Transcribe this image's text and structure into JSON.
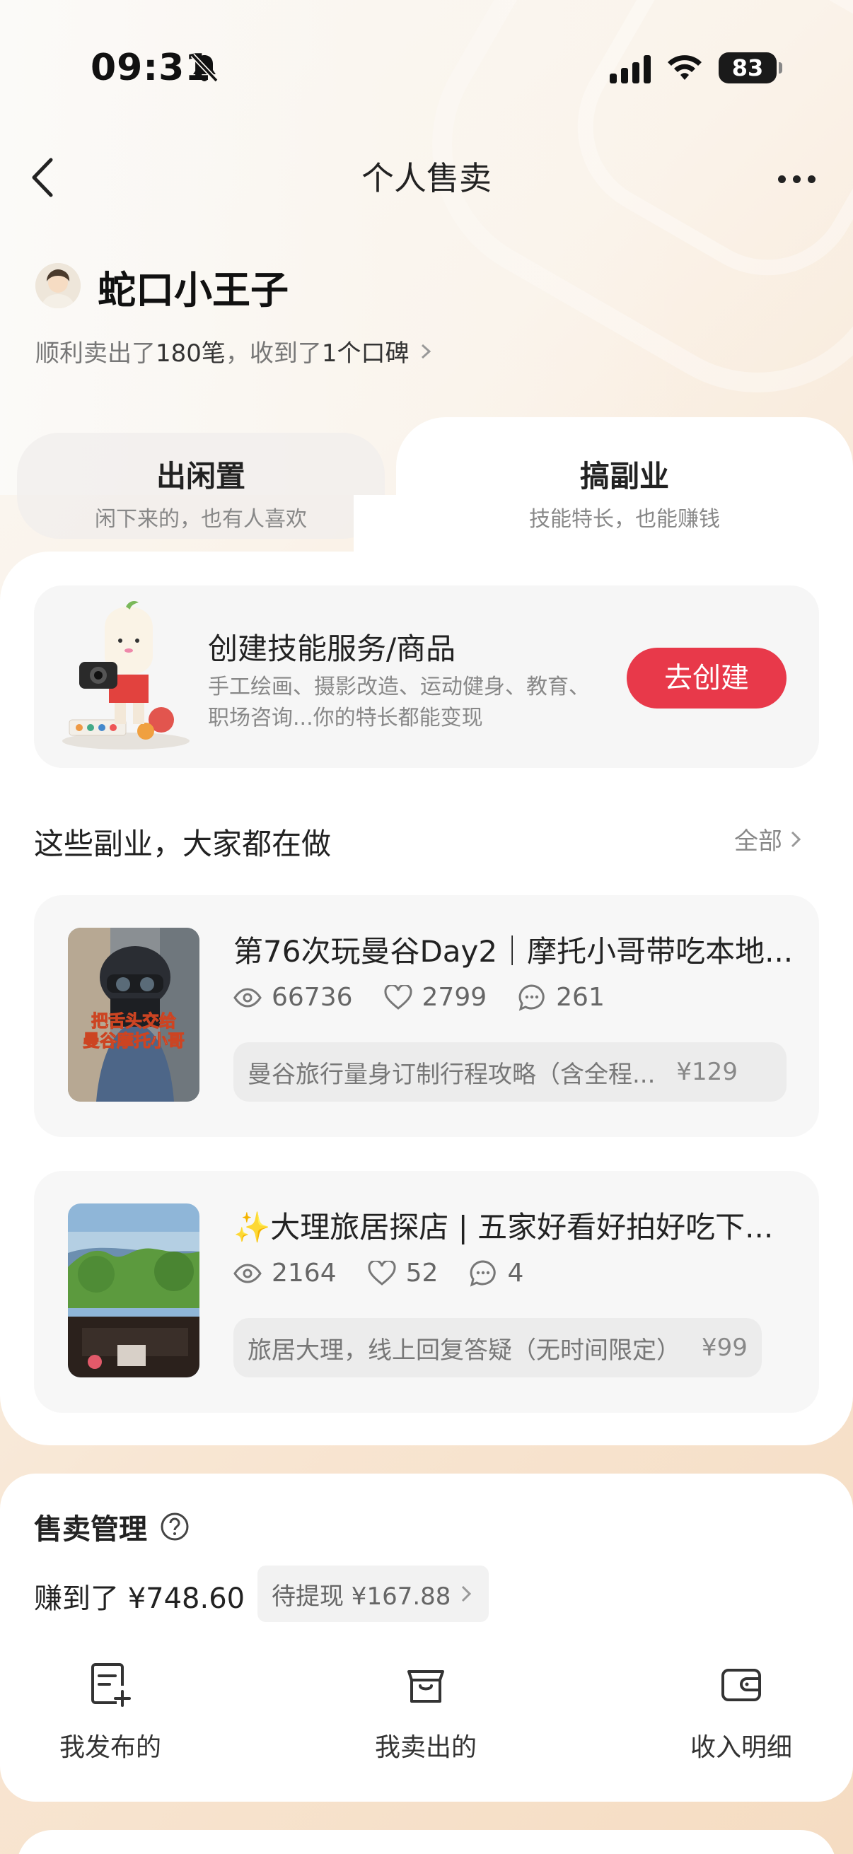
{
  "status_bar": {
    "time": "09:31",
    "battery": "83"
  },
  "nav": {
    "title": "个人售卖"
  },
  "user": {
    "name": "蛇口小王子",
    "stats_prefix": "顺利卖出了",
    "sold_count": "180笔",
    "stats_mid": "，收到了",
    "review_count": "1个口碑"
  },
  "tabs": [
    {
      "label": "出闲置",
      "sub": "闲下来的，也有人喜欢"
    },
    {
      "label": "搞副业",
      "sub": "技能特长，也能赚钱"
    }
  ],
  "create_card": {
    "title": "创建技能服务/商品",
    "desc": "手工绘画、摄影改造、运动健身、教育、职场咨询...你的特长都能变现",
    "button": "去创建"
  },
  "section": {
    "title": "这些副业，大家都在做",
    "all_label": "全部"
  },
  "items": [
    {
      "title": "第76次玩曼谷Day2｜摩托小哥带吃本地...",
      "views": "66736",
      "likes": "2799",
      "comments": "261",
      "offer": "曼谷旅行量身订制行程攻略（含全程...",
      "price": "¥129",
      "thumb_text": "把舌头交给曼谷摩托小哥"
    },
    {
      "title": "✨大理旅居探店 | 五家好看好拍好吃下...",
      "views": "2164",
      "likes": "52",
      "comments": "4",
      "offer": "旅居大理，线上回复答疑（无时间限定）",
      "price": "¥99"
    }
  ],
  "sales": {
    "title": "售卖管理",
    "earned": "赚到了 ¥748.60",
    "pending": "待提现 ¥167.88",
    "actions": [
      {
        "label": "我发布的",
        "icon": "publish-icon"
      },
      {
        "label": "我卖出的",
        "icon": "shop-box-icon"
      },
      {
        "label": "收入明细",
        "icon": "wallet-icon"
      }
    ]
  },
  "colors": {
    "accent": "#e8394a",
    "card_bg": "#f7f7f7"
  }
}
